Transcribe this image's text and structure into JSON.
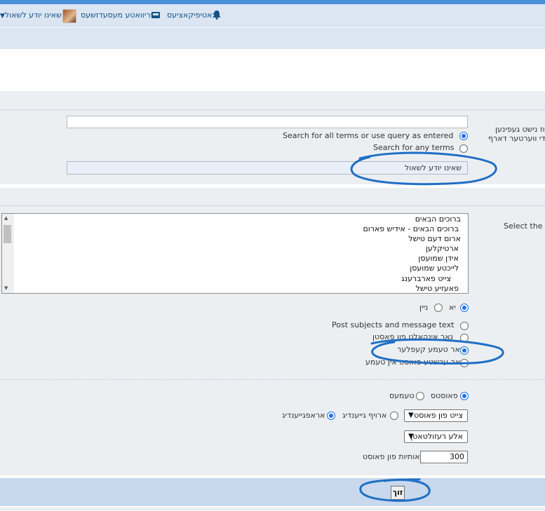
{
  "navbar": {
    "user_label": "שאינו יודע לשאול",
    "messages_label": "פריוואטע מעסעדזשעס",
    "notifications_label": "נאטיפיקאציעס"
  },
  "search": {
    "keywords_label_line1": "וז נישט געפינען",
    "keywords_label_line2": "ן די ווערטער דארף",
    "keywords_value": "",
    "terms_options": [
      {
        "label": "Search for all terms or use query as entered",
        "selected": true
      },
      {
        "label": "Search for any terms",
        "selected": false
      }
    ],
    "author_value": "שאינו יודע לשאול"
  },
  "forums": {
    "label": "Select the",
    "items": [
      "ברוכים הבאים",
      "ברוכים הבאים - אידיש פארום",
      "ארום דעם טישל",
      "ארטיקלען",
      "אידן שמועסן",
      "לייכטע שמועסן",
      "צייט פארברענג",
      "פאעזיע טישל"
    ],
    "subforums_yes": "יא",
    "subforums_no": "ניין"
  },
  "search_in": {
    "options": [
      {
        "label": "Post subjects and message text",
        "selected": false
      },
      {
        "label": "נאר אינהאלט פון פאסטן",
        "selected": false
      },
      {
        "label": "נאר טעמע קעפלער",
        "selected": true
      },
      {
        "label": "נאר ערשטע פאוסט אין טעמע",
        "selected": false
      }
    ]
  },
  "display": {
    "posts_label": "פאוסטס",
    "topics_label": "טעמעס",
    "sort_by_value": "צייט פון פאוסט",
    "ascending_label": "ארויף גייענדיג",
    "descending_label": "אראפגייענדיג",
    "time_limit_value": "אלע רעזולטאטן",
    "chars_label": "אותיות פון פאוסט",
    "chars_value": "300"
  },
  "submit_label": "זוך",
  "colors": {
    "accent": "#1a73e8",
    "navbar_bg": "#dce5f2",
    "panel_bg": "#eceff2",
    "annotation": "#1f6fc5"
  }
}
